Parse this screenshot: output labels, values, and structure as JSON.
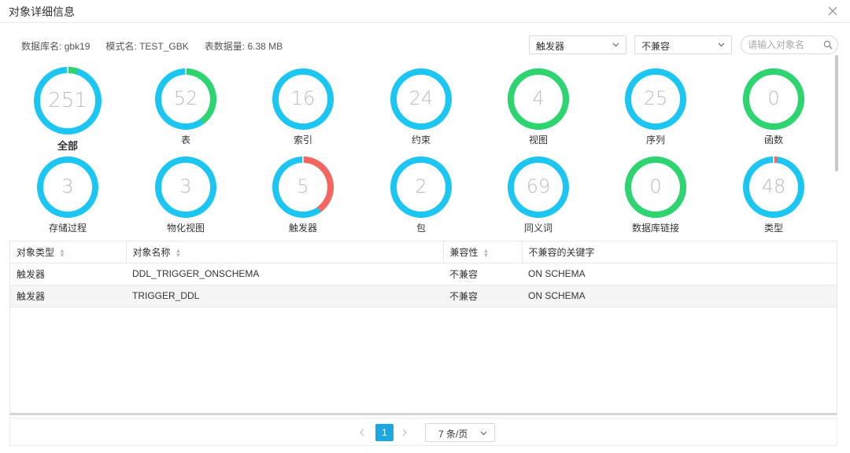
{
  "dialog": {
    "title": "对象详细信息"
  },
  "info": {
    "db_label": "数据库名:",
    "db_value": "gbk19",
    "schema_label": "模式名:",
    "schema_value": "TEST_GBK",
    "size_label": "表数据量:",
    "size_value": "6.38 MB"
  },
  "filters": {
    "type_select": "触发器",
    "compat_select": "不兼容",
    "search_placeholder": "请输入对象名"
  },
  "colors": {
    "compatible": "#2ed46e",
    "incompatible": "#f5675e",
    "neutral": "#1cc6f2",
    "accent": "#1ba7e0"
  },
  "stats": [
    {
      "label": "全部",
      "count": "251",
      "green": 5,
      "red": 0
    },
    {
      "label": "表",
      "count": "52",
      "green": 40,
      "red": 0
    },
    {
      "label": "索引",
      "count": "16",
      "green": 0,
      "red": 0
    },
    {
      "label": "约束",
      "count": "24",
      "green": 0,
      "red": 0
    },
    {
      "label": "视图",
      "count": "4",
      "green": 100,
      "red": 0
    },
    {
      "label": "序列",
      "count": "25",
      "green": 0,
      "red": 0
    },
    {
      "label": "函数",
      "count": "0",
      "green": 100,
      "red": 0
    },
    {
      "label": "存储过程",
      "count": "3",
      "green": 0,
      "red": 0
    },
    {
      "label": "物化视图",
      "count": "3",
      "green": 0,
      "red": 0
    },
    {
      "label": "触发器",
      "count": "5",
      "green": 0,
      "red": 40
    },
    {
      "label": "包",
      "count": "2",
      "green": 0,
      "red": 0
    },
    {
      "label": "同义词",
      "count": "69",
      "green": 0,
      "red": 0
    },
    {
      "label": "数据库链接",
      "count": "0",
      "green": 100,
      "red": 0
    },
    {
      "label": "类型",
      "count": "48",
      "green": 0,
      "red": 2
    }
  ],
  "table": {
    "headers": [
      "对象类型",
      "对象名称",
      "兼容性",
      "不兼容的关键字"
    ],
    "rows": [
      [
        "触发器",
        "DDL_TRIGGER_ONSCHEMA",
        "不兼容",
        "ON SCHEMA"
      ],
      [
        "触发器",
        "TRIGGER_DDL",
        "不兼容",
        "ON SCHEMA"
      ]
    ]
  },
  "pagination": {
    "current_page": "1",
    "page_size": "7 条/页"
  }
}
